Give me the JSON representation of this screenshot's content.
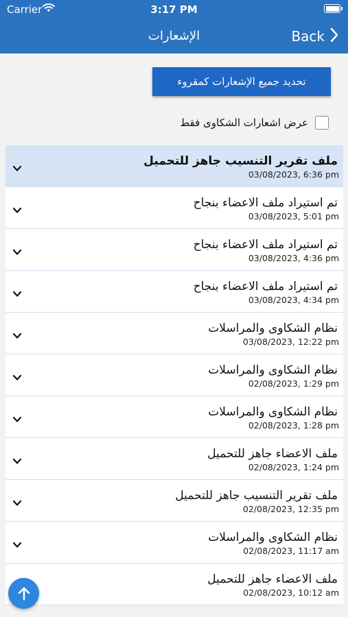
{
  "status_bar": {
    "carrier": "Carrier",
    "time": "3:17 PM"
  },
  "nav": {
    "title": "الإشعارات",
    "back_label": "Back"
  },
  "actions": {
    "mark_all_read": "تحديد جميع الإشعارات كمقروء"
  },
  "filter": {
    "label": "عرض  اشعارات الشكاوى فقط"
  },
  "notifications": [
    {
      "title": "ملف تقرير التنسيب جاهز للتحميل",
      "date": "03/08/2023, 6:36 pm"
    },
    {
      "title": "تم استيراد ملف الاعضاء بنجاح",
      "date": "03/08/2023, 5:01 pm"
    },
    {
      "title": "تم استيراد ملف الاعضاء بنجاح",
      "date": "03/08/2023, 4:36 pm"
    },
    {
      "title": "تم استيراد ملف الاعضاء بنجاح",
      "date": "03/08/2023, 4:34 pm"
    },
    {
      "title": "نظام الشكاوى والمراسلات",
      "date": "03/08/2023, 12:22 pm"
    },
    {
      "title": "نظام الشكاوى والمراسلات",
      "date": "02/08/2023, 1:29 pm"
    },
    {
      "title": "نظام الشكاوى والمراسلات",
      "date": "02/08/2023, 1:28 pm"
    },
    {
      "title": "ملف الاعضاء جاهز للتحميل",
      "date": "02/08/2023, 1:24 pm"
    },
    {
      "title": "ملف تقرير التنسيب جاهز للتحميل",
      "date": "02/08/2023, 12:35 pm"
    },
    {
      "title": "نظام الشكاوى والمراسلات",
      "date": "02/08/2023, 11:17 am"
    },
    {
      "title": "ملف الاعضاء جاهز للتحميل",
      "date": "02/08/2023, 10:12 am"
    }
  ],
  "colors": {
    "header": "#2a73c0",
    "button": "#1f67c5",
    "selected_row": "#d6e4f6",
    "fab": "#2e86de"
  }
}
